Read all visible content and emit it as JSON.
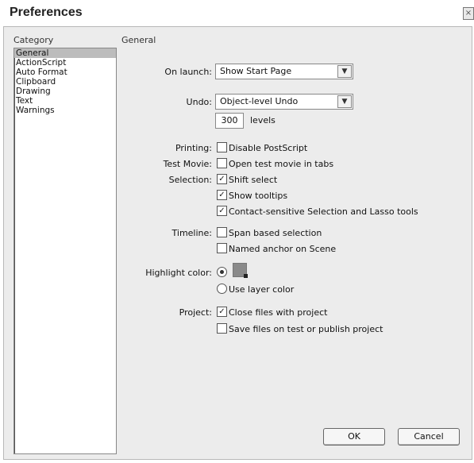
{
  "window": {
    "title": "Preferences",
    "close_glyph": "×"
  },
  "category": {
    "header": "Category",
    "items": [
      "General",
      "ActionScript",
      "Auto Format",
      "Clipboard",
      "Drawing",
      "Text",
      "Warnings"
    ],
    "selected": "General"
  },
  "section_header": "General",
  "on_launch": {
    "label": "On launch:",
    "value": "Show Start Page"
  },
  "undo": {
    "label": "Undo:",
    "value": "Object-level Undo",
    "levels_value": "300",
    "levels_label": "levels"
  },
  "printing": {
    "label": "Printing:",
    "option": "Disable PostScript",
    "checked": false
  },
  "test_movie": {
    "label": "Test Movie:",
    "option": "Open test movie in tabs",
    "checked": false
  },
  "selection": {
    "label": "Selection:",
    "options": [
      {
        "text": "Shift select",
        "checked": true
      },
      {
        "text": "Show tooltips",
        "checked": true
      },
      {
        "text": "Contact-sensitive Selection and Lasso tools",
        "checked": true
      }
    ]
  },
  "timeline": {
    "label": "Timeline:",
    "options": [
      {
        "text": "Span based selection",
        "checked": false
      },
      {
        "text": "Named anchor on Scene",
        "checked": false
      }
    ]
  },
  "highlight": {
    "label": "Highlight color:",
    "use_layer_color": "Use layer color",
    "selected": "swatch"
  },
  "project": {
    "label": "Project:",
    "options": [
      {
        "text": "Close files with project",
        "checked": true
      },
      {
        "text": "Save files on test or publish project",
        "checked": false
      }
    ]
  },
  "buttons": {
    "ok": "OK",
    "cancel": "Cancel"
  },
  "glyphs": {
    "check": "✓",
    "dropdown": "▼"
  }
}
